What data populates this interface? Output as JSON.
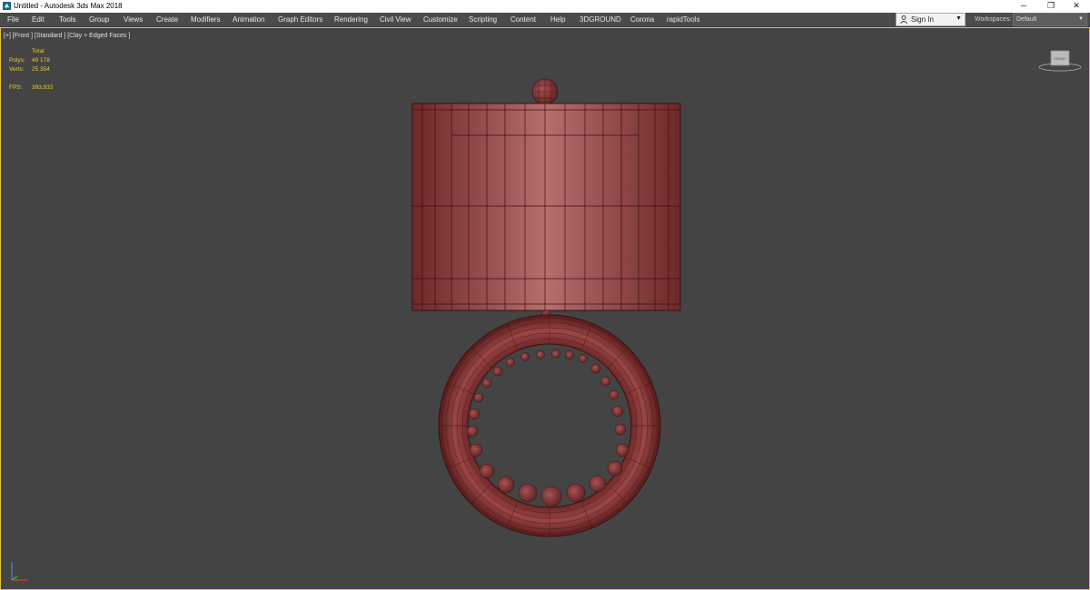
{
  "window": {
    "title": "Untitled - Autodesk 3ds Max 2018",
    "minimize": "─",
    "maximize": "❐",
    "close": "✕"
  },
  "menu": {
    "items": [
      "File",
      "Edit",
      "Tools",
      "Group",
      "Views",
      "Create",
      "Modifiers",
      "Animation",
      "Graph Editors",
      "Rendering",
      "Civil View",
      "Customize",
      "Scripting",
      "Content",
      "Help",
      "3DGROUND",
      "Corona",
      "rapidTools"
    ],
    "sign_in": "Sign In",
    "workspaces_label": "Workspaces:",
    "workspace_value": "Default"
  },
  "viewport": {
    "label": "[+] [Front ] [Standard ] [Clay + Edged Faces ]",
    "stats": {
      "header": "Total",
      "polys_label": "Polys:",
      "polys_value": "49 178",
      "verts_label": "Verts:",
      "verts_value": "25 354",
      "fps_label": "FPS:",
      "fps_value": "393,933"
    },
    "viewcube_label": "FRONT"
  },
  "colors": {
    "model": "#8a3a3a",
    "wire": "#3a1010",
    "viewport_bg": "#444444",
    "stats_text": "#e3cf30"
  }
}
